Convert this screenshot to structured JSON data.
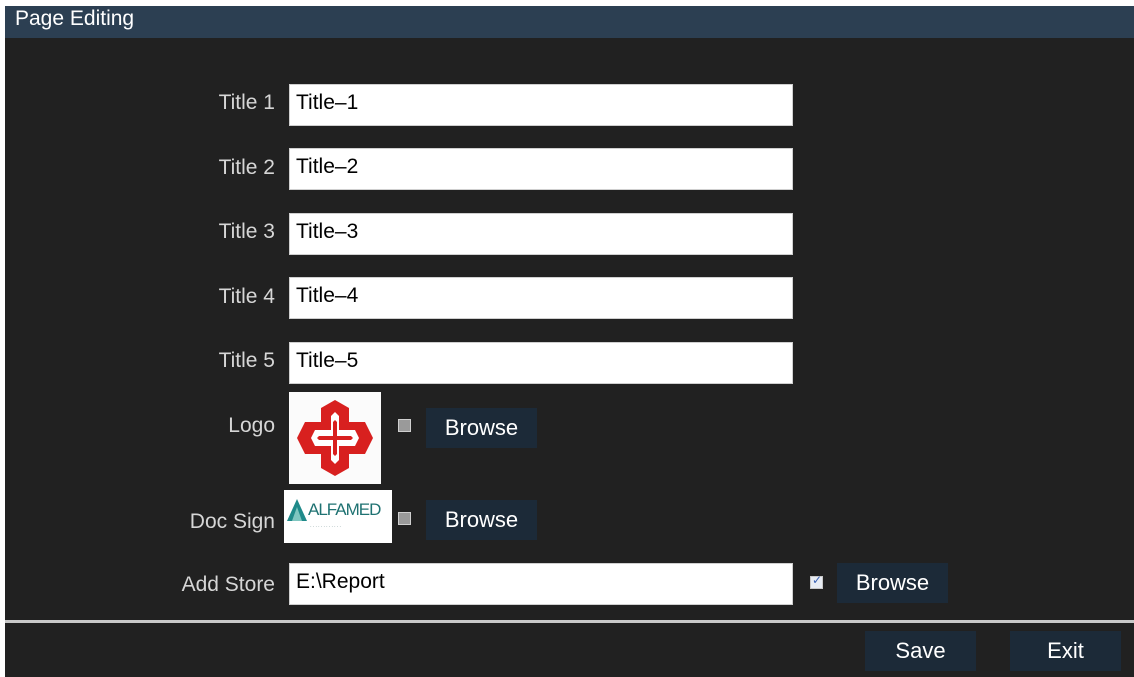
{
  "window": {
    "title": "Page Editing"
  },
  "fields": [
    {
      "label": "Title 1",
      "value": "Title–1"
    },
    {
      "label": "Title 2",
      "value": "Title–2"
    },
    {
      "label": "Title 3",
      "value": "Title–3"
    },
    {
      "label": "Title 4",
      "value": "Title–4"
    },
    {
      "label": "Title 5",
      "value": "Title–5"
    }
  ],
  "logo": {
    "label": "Logo",
    "checked": false,
    "browse_label": "Browse",
    "icon": "red-cross-logo"
  },
  "doc_sign": {
    "label": "Doc Sign",
    "image_text": "ALFAMED",
    "checked": false,
    "browse_label": "Browse"
  },
  "add_store": {
    "label": "Add Store",
    "value": "E:\\Report",
    "checked": true,
    "browse_label": "Browse"
  },
  "footer": {
    "save_label": "Save",
    "exit_label": "Exit"
  },
  "colors": {
    "titlebar": "#2c3f52",
    "background": "#212121",
    "button": "#1c2a38",
    "logo_red": "#d8201f",
    "sign_teal": "#1f7272"
  }
}
